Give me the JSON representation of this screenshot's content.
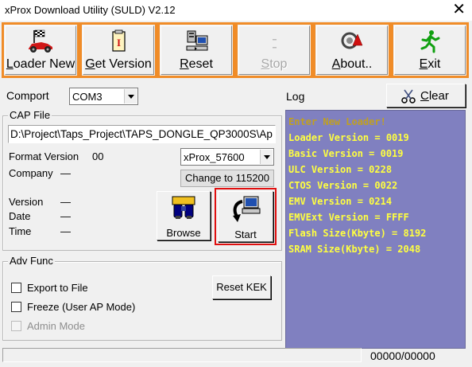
{
  "window": {
    "title": "xProx Download Utility (SULD) V2.12",
    "close_glyph": "✕"
  },
  "toolbar": {
    "buttons": [
      {
        "label": "Loader New",
        "underline": "L",
        "rest": "oader New",
        "icon": "racecar-icon",
        "enabled": true
      },
      {
        "label": "Get Version",
        "underline": "G",
        "rest": "et Version",
        "icon": "document-info-icon",
        "enabled": true
      },
      {
        "label": "Reset",
        "underline": "R",
        "rest": "eset",
        "icon": "computer-reset-icon",
        "enabled": true
      },
      {
        "label": "Stop",
        "underline": "S",
        "rest": "top",
        "icon": "stop-icon",
        "enabled": false
      },
      {
        "label": "About..",
        "underline": "A",
        "rest": "bout..",
        "icon": "about-logo-icon",
        "enabled": true
      },
      {
        "label": "Exit",
        "underline": "E",
        "rest": "xit",
        "icon": "running-man-icon",
        "enabled": true
      }
    ]
  },
  "comport": {
    "label": "Comport",
    "value": "COM3"
  },
  "log_header": {
    "label": "Log",
    "clear_label_u": "C",
    "clear_label_rest": "lear"
  },
  "cap_file": {
    "group_title": "CAP File",
    "path": "D:\\Project\\Taps_Project\\TAPS_DONGLE_QP3000S\\Ap",
    "format_label": "Format Version",
    "format_value": "00",
    "baud_value": "xProx_57600",
    "change_label": "Change to 115200",
    "company_label": "Company",
    "company_value": "—",
    "version_label": "Version",
    "version_value": "—",
    "date_label": "Date",
    "date_value": "—",
    "time_label": "Time",
    "time_value": "—",
    "browse_label": "Browse",
    "start_label": "Start"
  },
  "adv_func": {
    "group_title": "Adv Func",
    "export_label": "Export to File",
    "freeze_label": "Freeze (User AP Mode)",
    "admin_label": "Admin Mode",
    "reset_kek_label": "Reset KEK"
  },
  "log": {
    "lines": [
      "Enter New Loader!",
      "Loader Version = 0019",
      "Basic Version = 0019",
      "ULC Version = 0228",
      "CTOS Version = 0022",
      "EMV Version = 0214",
      "EMVExt Version = FFFF",
      "Flash Size(Kbyte) = 8192",
      "SRAM Size(Kbyte) = 2048"
    ]
  },
  "status": {
    "counter": "00000/00000"
  },
  "colors": {
    "toolbar_border": "#f08c28",
    "log_bg": "#8080c0",
    "log_text": "#ffff40",
    "start_highlight": "#e01010"
  }
}
